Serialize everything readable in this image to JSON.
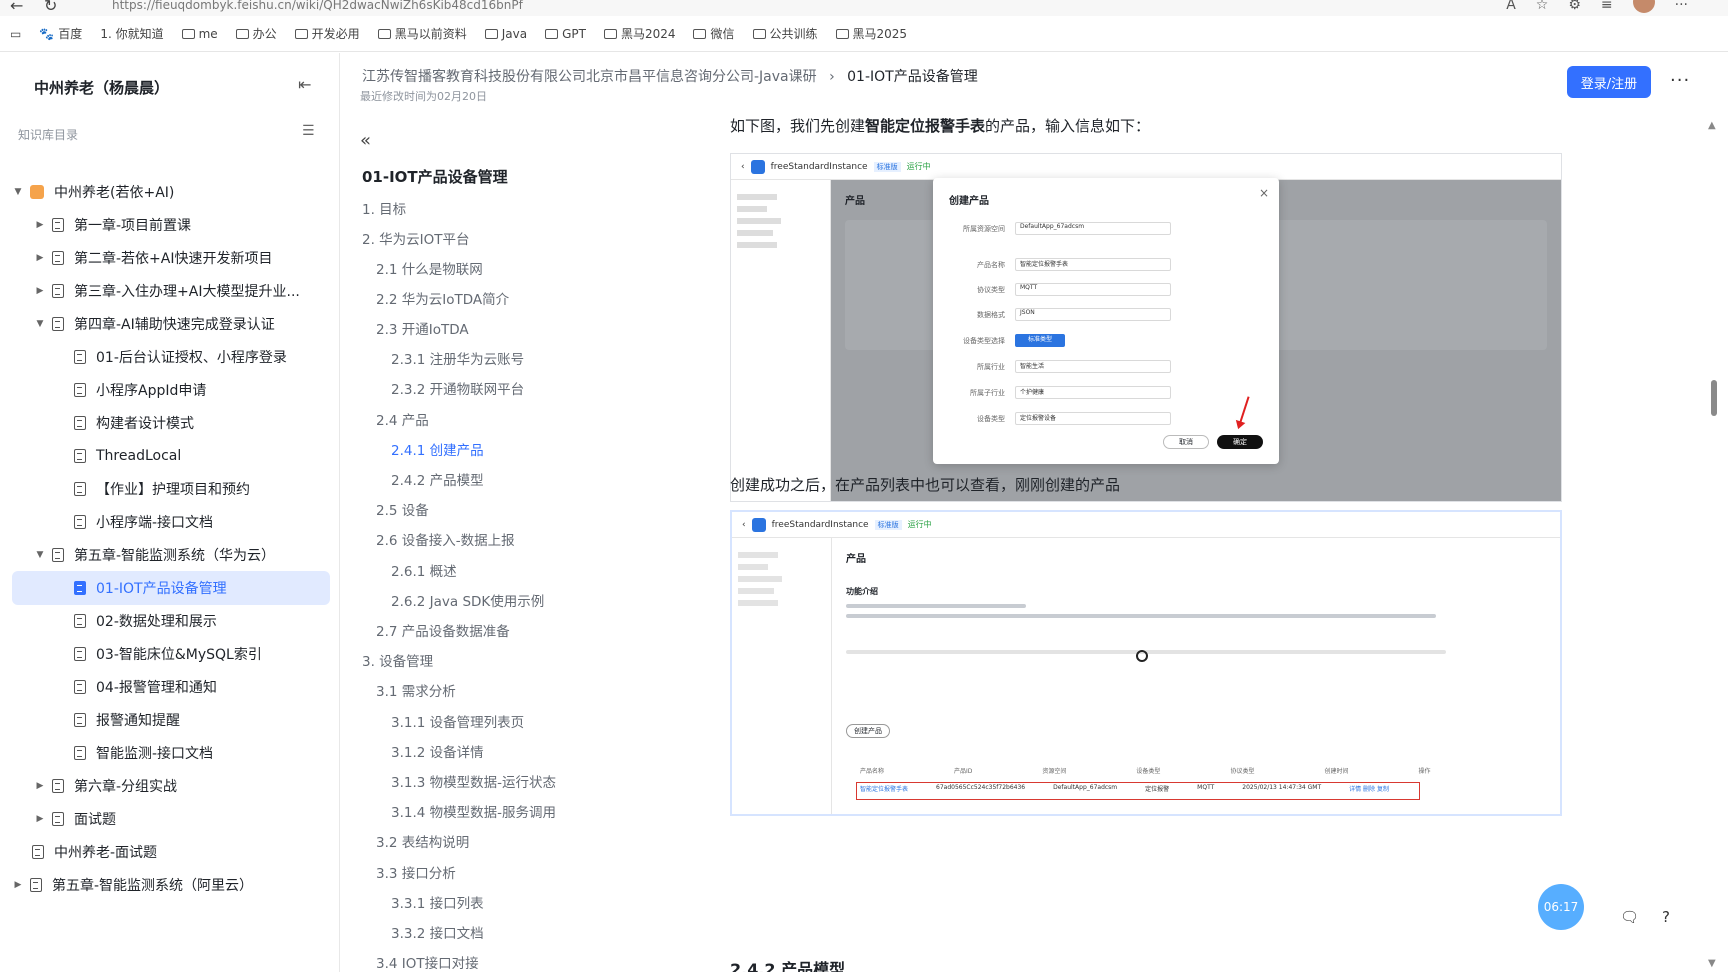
{
  "browser": {
    "url": "https://fieuqdombyk.feishu.cn/wiki/QH2dwacNwiZh6sKib48cd16bnPf",
    "bookmarks": [
      "百度",
      "1. 你就知道",
      "me",
      "办公",
      "开发必用",
      "黑马以前资料",
      "Java",
      "GPT",
      "黑马2024",
      "微信",
      "公共训练",
      "黑马2025"
    ]
  },
  "sidebar": {
    "space_title": "中州养老（杨晨晨）",
    "kb_label": "知识库目录",
    "items": [
      {
        "label": "中州养老(若依+AI)",
        "level": 0
      },
      {
        "label": "第一章-项目前置课",
        "level": 1
      },
      {
        "label": "第二章-若依+AI快速开发新项目",
        "level": 1
      },
      {
        "label": "第三章-入住办理+AI大模型提升业...",
        "level": 1
      },
      {
        "label": "第四章-AI辅助快速完成登录认证",
        "level": 1
      },
      {
        "label": "01-后台认证授权、小程序登录",
        "level": 2
      },
      {
        "label": "小程序AppId申请",
        "level": 2
      },
      {
        "label": "构建者设计模式",
        "level": 2
      },
      {
        "label": "ThreadLocal",
        "level": 2
      },
      {
        "label": "【作业】护理项目和预约",
        "level": 2
      },
      {
        "label": "小程序端-接口文档",
        "level": 2
      },
      {
        "label": "第五章-智能监测系统（华为云）",
        "level": 1
      },
      {
        "label": "01-IOT产品设备管理",
        "level": 2
      },
      {
        "label": "02-数据处理和展示",
        "level": 2
      },
      {
        "label": "03-智能床位&MySQL索引",
        "level": 2
      },
      {
        "label": "04-报警管理和通知",
        "level": 2
      },
      {
        "label": "报警通知提醒",
        "level": 2
      },
      {
        "label": "智能监测-接口文档",
        "level": 2
      },
      {
        "label": "第六章-分组实战",
        "level": 1
      },
      {
        "label": "面试题",
        "level": 1
      },
      {
        "label": "中州养老-面试题",
        "level": 0
      },
      {
        "label": "第五章-智能监测系统（阿里云）",
        "level": 0
      }
    ]
  },
  "header": {
    "breadcrumb_parent": "江苏传智播客教育科技股份有限公司北京市昌平信息咨询分公司-Java课研",
    "breadcrumb_sep": "›",
    "breadcrumb_current": "01-IOT产品设备管理",
    "edit_time": "最近修改时间为02月20日",
    "login_label": "登录/注册",
    "more_label": "···"
  },
  "toc": {
    "title": "01-IOT产品设备管理",
    "items": [
      {
        "label": "1. 目标"
      },
      {
        "label": "2. 华为云IOT平台"
      },
      {
        "label": "2.1 什么是物联网"
      },
      {
        "label": "2.2 华为云IoTDA简介"
      },
      {
        "label": "2.3 开通IoTDA"
      },
      {
        "label": "2.3.1 注册华为云账号"
      },
      {
        "label": "2.3.2 开通物联网平台"
      },
      {
        "label": "2.4 产品"
      },
      {
        "label": "2.4.1 创建产品"
      },
      {
        "label": "2.4.2 产品模型"
      },
      {
        "label": "2.5 设备"
      },
      {
        "label": "2.6 设备接入-数据上报"
      },
      {
        "label": "2.6.1 概述"
      },
      {
        "label": "2.6.2 Java SDK使用示例"
      },
      {
        "label": "2.7 产品设备数据准备"
      },
      {
        "label": "3. 设备管理"
      },
      {
        "label": "3.1 需求分析"
      },
      {
        "label": "3.1.1 设备管理列表页"
      },
      {
        "label": "3.1.2 设备详情"
      },
      {
        "label": "3.1.3 物模型数据-运行状态"
      },
      {
        "label": "3.1.4 物模型数据-服务调用"
      },
      {
        "label": "3.2 表结构说明"
      },
      {
        "label": "3.3 接口分析"
      },
      {
        "label": "3.3.1 接口列表"
      },
      {
        "label": "3.3.2 接口文档"
      },
      {
        "label": "3.4 IOT接口对接"
      }
    ]
  },
  "doc": {
    "para1_pre": "如下图，我们先创建",
    "para1_bold": "智能定位报警手表",
    "para1_post": "的产品，输入信息如下：",
    "para2": "创建成功之后，在产品列表中也可以查看，刚刚创建的产品",
    "heading_next": "2.4.2 产品模型",
    "shot1": {
      "instance": "freeStandardInstance",
      "tag": "标准版",
      "status": "运行中",
      "page_title": "产品",
      "dialog_title": "创建产品",
      "fields": [
        {
          "label": "所属资源空间",
          "value": "DefaultApp_67adcsm"
        },
        {
          "label": "产品名称",
          "value": "智能定位报警手表"
        },
        {
          "label": "协议类型",
          "value": "MQTT"
        },
        {
          "label": "数据格式",
          "value": "JSON"
        },
        {
          "label": "设备类型选择",
          "value": "标准类型"
        },
        {
          "label": "所属行业",
          "value": "智能生活"
        },
        {
          "label": "所属子行业",
          "value": "个护健康"
        },
        {
          "label": "设备类型",
          "value": "定位报警设备"
        }
      ],
      "cancel": "取消",
      "confirm": "确定"
    },
    "shot2": {
      "instance": "freeStandardInstance",
      "tag": "标准版",
      "status": "运行中",
      "page_title": "产品",
      "section": "功能介绍",
      "create_btn": "创建产品",
      "columns": [
        "产品名称",
        "产品ID",
        "资源空间",
        "设备类型",
        "协议类型",
        "创建时间",
        "操作"
      ],
      "row": [
        "智能定位报警手表",
        "67ad0565Cc524c35f72b6436",
        "DefaultApp_67adcsm",
        "定位报警",
        "MQTT",
        "2025/02/13 14:47:34 GMT",
        "详情 删除 复制"
      ]
    }
  },
  "timer": "06:17"
}
